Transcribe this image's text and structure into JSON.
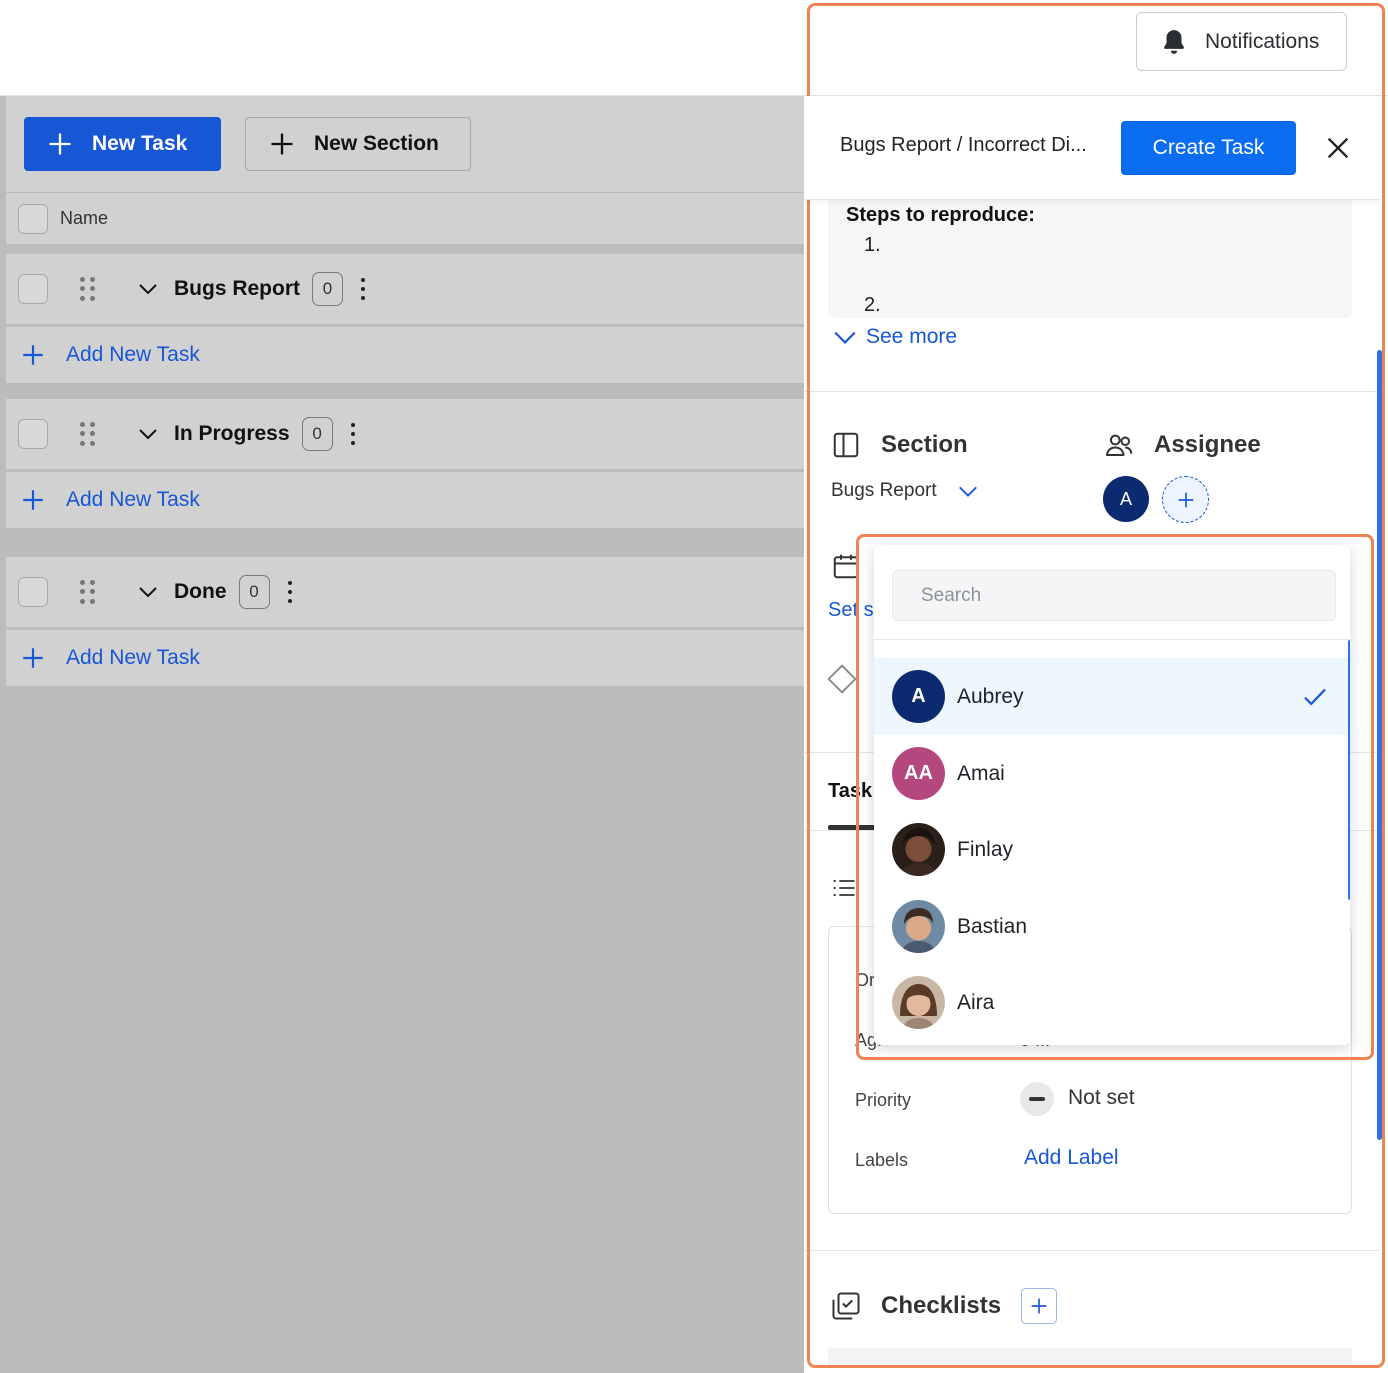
{
  "topbar": {
    "notifications_label": "Notifications"
  },
  "toolbar": {
    "new_task_label": "New Task",
    "new_section_label": "New Section"
  },
  "table": {
    "name_header": "Name"
  },
  "sections": [
    {
      "name": "Bugs Report",
      "count": "0",
      "add_label": "Add New Task"
    },
    {
      "name": "In Progress",
      "count": "0",
      "add_label": "Add New Task"
    },
    {
      "name": "Done",
      "count": "0",
      "add_label": "Add New Task"
    }
  ],
  "panel": {
    "breadcrumb": "Bugs Report  / Incorrect Di...",
    "create_label": "Create Task",
    "description": {
      "heading": "Steps to reproduce:",
      "items": [
        "1.",
        "2."
      ]
    },
    "see_more": "See more",
    "section_title": "Section",
    "section_value": "Bugs Report",
    "assignee_title": "Assignee",
    "assignee_initial": "A",
    "partial": {
      "date_link": "Set s",
      "tasks_tab": "Task",
      "detail_row_1": "Or",
      "detail_row_2": "Ag.",
      "detail_row_2_value": "0 ..."
    },
    "priority_label": "Priority",
    "priority_value": "Not set",
    "labels_label": "Labels",
    "add_label": "Add Label",
    "checklists_title": "Checklists"
  },
  "dropdown": {
    "search_placeholder": "Search",
    "people": [
      {
        "name": "Aubrey",
        "initials": "A",
        "color": "#0b2a6f",
        "selected": true
      },
      {
        "name": "Amai",
        "initials": "AA",
        "color": "#b5477f",
        "selected": false
      },
      {
        "name": "Finlay",
        "initials": "",
        "color": "#3a2a24",
        "selected": false
      },
      {
        "name": "Bastian",
        "initials": "",
        "color": "#5a7088",
        "selected": false
      },
      {
        "name": "Aira",
        "initials": "",
        "color": "#8a6a55",
        "selected": false
      }
    ]
  },
  "colors": {
    "primary": "#0a6cf0",
    "highlight": "#f08352",
    "link": "#1757d6"
  }
}
